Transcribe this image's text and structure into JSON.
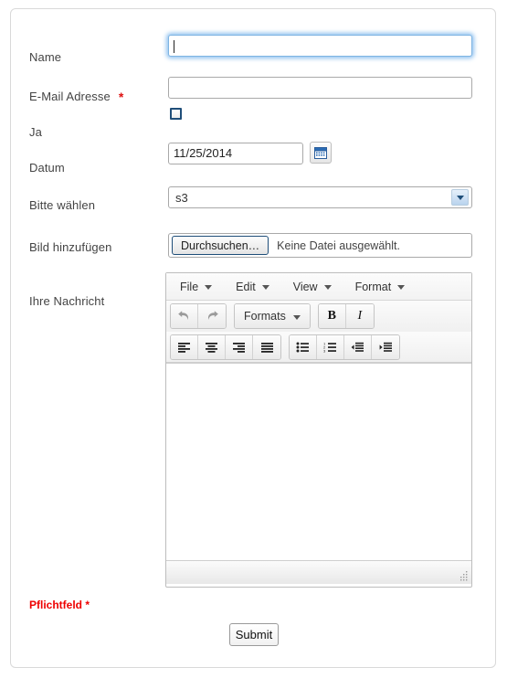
{
  "form": {
    "fields": [
      {
        "label": "Name",
        "type": "text",
        "value": "",
        "required": false,
        "focused": true
      },
      {
        "label": "E-Mail Adresse",
        "type": "text",
        "value": "",
        "required": true,
        "required_marker": "*"
      },
      {
        "label": "Ja",
        "type": "checkbox",
        "checked": false
      },
      {
        "label": "Datum",
        "type": "date",
        "value": "11/25/2014"
      },
      {
        "label": "Bitte wählen",
        "type": "select",
        "value": "s3"
      },
      {
        "label": "Bild hinzufügen",
        "type": "file",
        "button_label": "Durchsuchen…",
        "status": "Keine Datei ausgewählt."
      },
      {
        "label": "Ihre Nachricht",
        "type": "richtext",
        "value": ""
      }
    ],
    "required_note": "Pflichtfeld *",
    "submit_label": "Submit"
  },
  "editor": {
    "menubar": [
      {
        "label": "File",
        "icon": "chevron-down-icon"
      },
      {
        "label": "Edit",
        "icon": "chevron-down-icon"
      },
      {
        "label": "View",
        "icon": "chevron-down-icon"
      },
      {
        "label": "Format",
        "icon": "chevron-down-icon"
      }
    ],
    "toolbar_row1": [
      {
        "name": "undo",
        "icon": "undo-icon",
        "label": ""
      },
      {
        "name": "redo",
        "icon": "redo-icon",
        "label": ""
      },
      {
        "name": "formats",
        "icon": "chevron-down-icon",
        "label": "Formats"
      },
      {
        "name": "bold",
        "icon": "bold-icon",
        "label": "B"
      },
      {
        "name": "italic",
        "icon": "italic-icon",
        "label": "I"
      }
    ],
    "toolbar_row2": [
      {
        "name": "align-left",
        "icon": "align-left-icon"
      },
      {
        "name": "align-center",
        "icon": "align-center-icon"
      },
      {
        "name": "align-right",
        "icon": "align-right-icon"
      },
      {
        "name": "align-justify",
        "icon": "align-justify-icon"
      },
      {
        "name": "bullist",
        "icon": "unordered-list-icon"
      },
      {
        "name": "numlist",
        "icon": "ordered-list-icon"
      },
      {
        "name": "outdent",
        "icon": "outdent-icon"
      },
      {
        "name": "indent",
        "icon": "indent-icon"
      }
    ],
    "content": "",
    "statusbar_grip": "resize-grip-icon"
  },
  "colors": {
    "required": "#dd1111",
    "note": "#ee0000",
    "checkbox_border": "#1f4e79",
    "focus_glow": "#7eb4e2",
    "select_arrow": "#1f4e79"
  }
}
